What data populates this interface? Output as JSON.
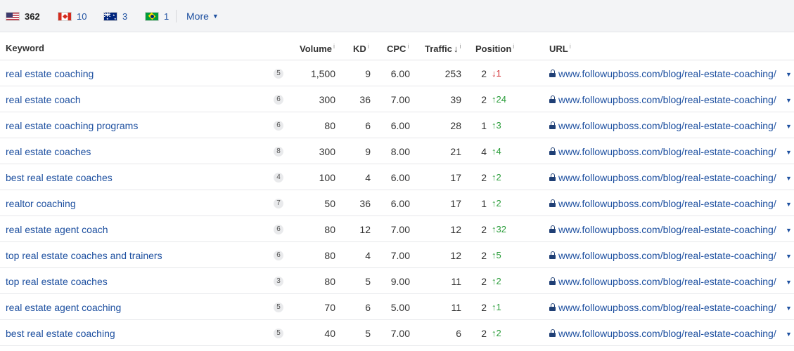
{
  "countries": [
    {
      "icon": "us-flag-icon",
      "count": "362",
      "active": true
    },
    {
      "icon": "canada-flag-icon",
      "count": "10",
      "active": false
    },
    {
      "icon": "australia-flag-icon",
      "count": "3",
      "active": false
    },
    {
      "icon": "brazil-flag-icon",
      "count": "1",
      "active": false
    }
  ],
  "more_label": "More",
  "columns": {
    "keyword": "Keyword",
    "volume": "Volume",
    "kd": "KD",
    "cpc": "CPC",
    "traffic": "Traffic",
    "position": "Position",
    "url": "URL",
    "info_mark": "i",
    "sort_arrow": "↓"
  },
  "colors": {
    "link": "#1e50a0",
    "up": "#2a9d3a",
    "down": "#d1262c",
    "header_bg": "#f3f4f6"
  },
  "rows": [
    {
      "keyword": "real estate coaching",
      "serp": "5",
      "volume": "1,500",
      "kd": "9",
      "cpc": "6.00",
      "traffic": "253",
      "position": "2",
      "change_dir": "down",
      "change_arrow": "↓",
      "change": "1",
      "url": "www.followupboss.com/blog/real-estate-coaching/"
    },
    {
      "keyword": "real estate coach",
      "serp": "6",
      "volume": "300",
      "kd": "36",
      "cpc": "7.00",
      "traffic": "39",
      "position": "2",
      "change_dir": "up",
      "change_arrow": "↑",
      "change": "24",
      "url": "www.followupboss.com/blog/real-estate-coaching/"
    },
    {
      "keyword": "real estate coaching programs",
      "serp": "6",
      "volume": "80",
      "kd": "6",
      "cpc": "6.00",
      "traffic": "28",
      "position": "1",
      "change_dir": "up",
      "change_arrow": "↑",
      "change": "3",
      "url": "www.followupboss.com/blog/real-estate-coaching/"
    },
    {
      "keyword": "real estate coaches",
      "serp": "8",
      "volume": "300",
      "kd": "9",
      "cpc": "8.00",
      "traffic": "21",
      "position": "4",
      "change_dir": "up",
      "change_arrow": "↑",
      "change": "4",
      "url": "www.followupboss.com/blog/real-estate-coaching/"
    },
    {
      "keyword": "best real estate coaches",
      "serp": "4",
      "volume": "100",
      "kd": "4",
      "cpc": "6.00",
      "traffic": "17",
      "position": "2",
      "change_dir": "up",
      "change_arrow": "↑",
      "change": "2",
      "url": "www.followupboss.com/blog/real-estate-coaching/"
    },
    {
      "keyword": "realtor coaching",
      "serp": "7",
      "volume": "50",
      "kd": "36",
      "cpc": "6.00",
      "traffic": "17",
      "position": "1",
      "change_dir": "up",
      "change_arrow": "↑",
      "change": "2",
      "url": "www.followupboss.com/blog/real-estate-coaching/"
    },
    {
      "keyword": "real estate agent coach",
      "serp": "6",
      "volume": "80",
      "kd": "12",
      "cpc": "7.00",
      "traffic": "12",
      "position": "2",
      "change_dir": "up",
      "change_arrow": "↑",
      "change": "32",
      "url": "www.followupboss.com/blog/real-estate-coaching/"
    },
    {
      "keyword": "top real estate coaches and trainers",
      "serp": "6",
      "volume": "80",
      "kd": "4",
      "cpc": "7.00",
      "traffic": "12",
      "position": "2",
      "change_dir": "up",
      "change_arrow": "↑",
      "change": "5",
      "url": "www.followupboss.com/blog/real-estate-coaching/"
    },
    {
      "keyword": "top real estate coaches",
      "serp": "3",
      "volume": "80",
      "kd": "5",
      "cpc": "9.00",
      "traffic": "11",
      "position": "2",
      "change_dir": "up",
      "change_arrow": "↑",
      "change": "2",
      "url": "www.followupboss.com/blog/real-estate-coaching/"
    },
    {
      "keyword": "real estate agent coaching",
      "serp": "5",
      "volume": "70",
      "kd": "6",
      "cpc": "5.00",
      "traffic": "11",
      "position": "2",
      "change_dir": "up",
      "change_arrow": "↑",
      "change": "1",
      "url": "www.followupboss.com/blog/real-estate-coaching/"
    },
    {
      "keyword": "best real estate coaching",
      "serp": "5",
      "volume": "40",
      "kd": "5",
      "cpc": "7.00",
      "traffic": "6",
      "position": "2",
      "change_dir": "up",
      "change_arrow": "↑",
      "change": "2",
      "url": "www.followupboss.com/blog/real-estate-coaching/"
    }
  ]
}
